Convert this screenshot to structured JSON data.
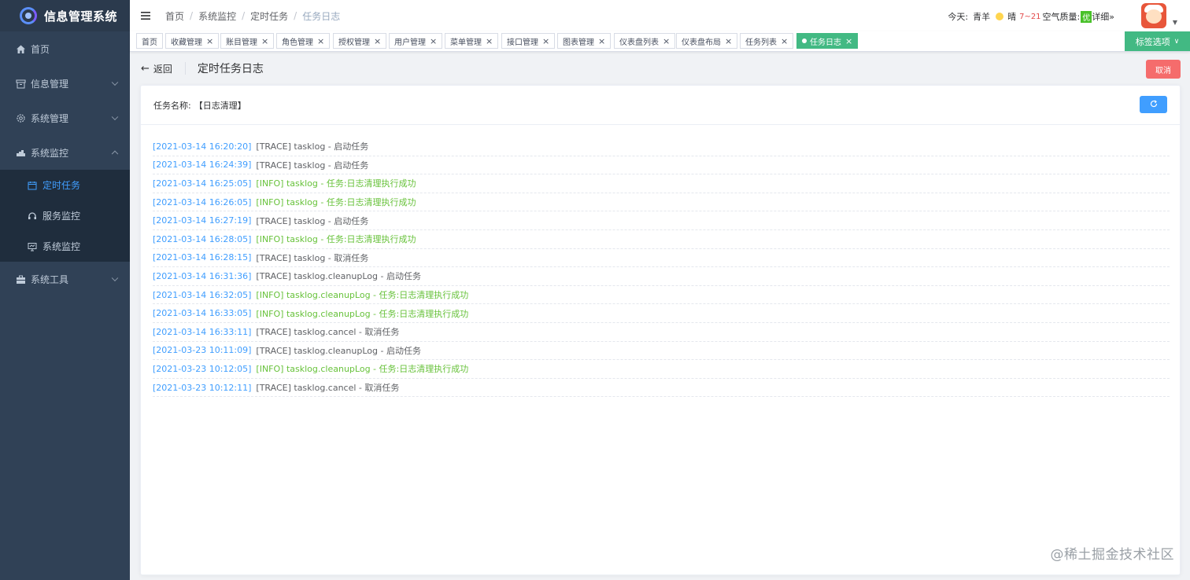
{
  "app": {
    "title": "信息管理系统"
  },
  "sidebar": {
    "items": [
      {
        "label": "首页",
        "icon": "home-icon"
      },
      {
        "label": "信息管理",
        "icon": "box-icon"
      },
      {
        "label": "系统管理",
        "icon": "gear-icon"
      },
      {
        "label": "系统监控",
        "icon": "monitor-icon"
      },
      {
        "label": "系统工具",
        "icon": "toolbox-icon"
      }
    ],
    "monitor_sub": [
      {
        "label": "定时任务",
        "icon": "calendar-icon",
        "active": true
      },
      {
        "label": "服务监控",
        "icon": "headset-icon"
      },
      {
        "label": "系统监控",
        "icon": "screen-icon"
      }
    ]
  },
  "navbar": {
    "breadcrumb": [
      "首页",
      "系统监控",
      "定时任务",
      "任务日志"
    ],
    "weather": {
      "today_label": "今天:",
      "city": "青羊",
      "condition": "晴",
      "temp": "7~21",
      "aqi_label": "空气质量:",
      "aqi_value": "优",
      "detail": "详细»"
    }
  },
  "tags": [
    "首页",
    "收藏管理",
    "账目管理",
    "角色管理",
    "授权管理",
    "用户管理",
    "菜单管理",
    "接口管理",
    "图表管理",
    "仪表盘列表",
    "仪表盘布局",
    "任务列表",
    "任务日志"
  ],
  "tag_options_label": "标签选项",
  "page": {
    "back_label": "返回",
    "title": "定时任务日志",
    "cancel_label": "取消",
    "task_name_label": "任务名称:",
    "task_name_value": "【日志清理】"
  },
  "logs": [
    {
      "time": "[2021-03-14 16:20:20]",
      "msg": "[TRACE] tasklog - 启动任务",
      "level": "trace"
    },
    {
      "time": "[2021-03-14 16:24:39]",
      "msg": "[TRACE] tasklog - 启动任务",
      "level": "trace"
    },
    {
      "time": "[2021-03-14 16:25:05]",
      "msg": "[INFO] tasklog - 任务:日志清理执行成功",
      "level": "info"
    },
    {
      "time": "[2021-03-14 16:26:05]",
      "msg": "[INFO] tasklog - 任务:日志清理执行成功",
      "level": "info"
    },
    {
      "time": "[2021-03-14 16:27:19]",
      "msg": "[TRACE] tasklog - 启动任务",
      "level": "trace"
    },
    {
      "time": "[2021-03-14 16:28:05]",
      "msg": "[INFO] tasklog - 任务:日志清理执行成功",
      "level": "info"
    },
    {
      "time": "[2021-03-14 16:28:15]",
      "msg": "[TRACE] tasklog - 取消任务",
      "level": "trace"
    },
    {
      "time": "[2021-03-14 16:31:36]",
      "msg": "[TRACE] tasklog.cleanupLog - 启动任务",
      "level": "trace"
    },
    {
      "time": "[2021-03-14 16:32:05]",
      "msg": "[INFO] tasklog.cleanupLog - 任务:日志清理执行成功",
      "level": "info"
    },
    {
      "time": "[2021-03-14 16:33:05]",
      "msg": "[INFO] tasklog.cleanupLog - 任务:日志清理执行成功",
      "level": "info"
    },
    {
      "time": "[2021-03-14 16:33:11]",
      "msg": "[TRACE] tasklog.cancel - 取消任务",
      "level": "trace"
    },
    {
      "time": "[2021-03-23 10:11:09]",
      "msg": "[TRACE] tasklog.cleanupLog - 启动任务",
      "level": "trace"
    },
    {
      "time": "[2021-03-23 10:12:05]",
      "msg": "[INFO] tasklog.cleanupLog - 任务:日志清理执行成功",
      "level": "info"
    },
    {
      "time": "[2021-03-23 10:12:11]",
      "msg": "[TRACE] tasklog.cancel - 取消任务",
      "level": "trace"
    }
  ],
  "watermark": "@稀土掘金技术社区",
  "colors": {
    "sidebar_bg": "#304156",
    "active_tag": "#42b983",
    "danger": "#f56c6c",
    "primary": "#409eff",
    "info_text": "#67c23a"
  }
}
